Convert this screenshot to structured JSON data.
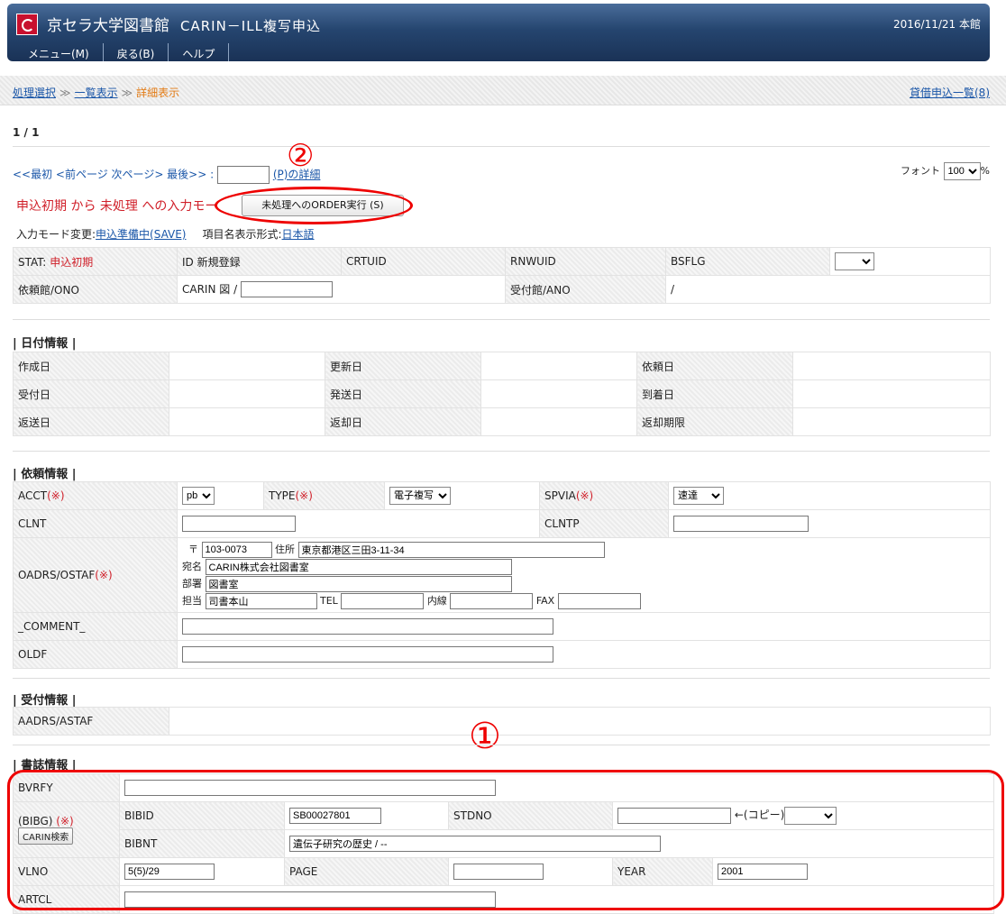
{
  "header": {
    "app": "京セラ大学図書館",
    "system": "CARIN－ILL複写申込",
    "date": "2016/11/21 本館"
  },
  "menu": [
    "メニュー(M)",
    "戻る(B)",
    "ヘルプ"
  ],
  "breadcrumb": {
    "step1": "処理選択",
    "sep": "≫",
    "step2": "一覧表示",
    "current": "詳細表示",
    "right": "貸借申込一覧(8)"
  },
  "page": "1 / 1",
  "nav": {
    "text": "<<最初 <前ページ 次ページ> 最後>> :",
    "detail": "(P)の詳細",
    "font_label": "フォント",
    "font_value": "100",
    "font_pct": "%"
  },
  "mode": {
    "text": "申込初期 から 未処理 への入力モー",
    "order_button": "未処理へのORDER実行 (S)",
    "change_label": "入力モード変更:",
    "change_link": "申込準備中(SAVE)",
    "display_label": "項目名表示形式:",
    "display_link": "日本語"
  },
  "status": {
    "stat": "STAT:",
    "stat_val": "申込初期",
    "id": "ID 新規登録",
    "crtuid": "CRTUID",
    "rnwuid": "RNWUID",
    "bsflg": "BSFLG",
    "ono_label": "依頼館/ONO",
    "ono_prefix": "CARIN 図 /",
    "ano_label": "受付館/ANO",
    "ano_val": "/"
  },
  "dates": {
    "title": "| 日付情報 |",
    "labels": [
      "作成日",
      "更新日",
      "依頼日",
      "受付日",
      "発送日",
      "到着日",
      "返送日",
      "返却日",
      "返却期限"
    ]
  },
  "request": {
    "title": "| 依頼情報 |",
    "acct": "ACCT",
    "acct_val": "pb",
    "type": "TYPE",
    "type_val": "電子複写",
    "spvia": "SPVIA",
    "spvia_val": "速達",
    "req": "(※)",
    "clnt": "CLNT",
    "clntp": "CLNTP",
    "oadrs": "OADRS/OSTAF",
    "zip_label": "〒",
    "zip": "103-0073",
    "addr_label": "住所",
    "addr": "東京都港区三田3-11-34",
    "dest_label": "宛名",
    "dest": "CARIN株式会社図書室",
    "dept_label": "部署",
    "dept": "図書室",
    "staff_label": "担当",
    "staff": "司書本山",
    "tel": "TEL",
    "ext": "内線",
    "fax": "FAX",
    "comment": "_COMMENT_",
    "oldf": "OLDF"
  },
  "receive": {
    "title": "| 受付情報 |",
    "aadrs": "AADRS/ASTAF"
  },
  "biblio": {
    "title": "| 書誌情報 |",
    "bvrfy": "BVRFY",
    "bibg": "(BIBG)",
    "req": "(※)",
    "carin_btn": "CARIN検索",
    "bibid": "BIBID",
    "bibid_val": "SB00027801",
    "stdno": "STDNO",
    "copy": "←(コピー)",
    "bibnt": "BIBNT",
    "bibnt_val": "遺伝子研究の歴史 / --",
    "vlno": "VLNO",
    "vlno_val": "5(5)/29",
    "page": "PAGE",
    "year": "YEAR",
    "year_val": "2001",
    "artcl": "ARTCL"
  },
  "annotations": {
    "one": "①",
    "two": "②"
  }
}
